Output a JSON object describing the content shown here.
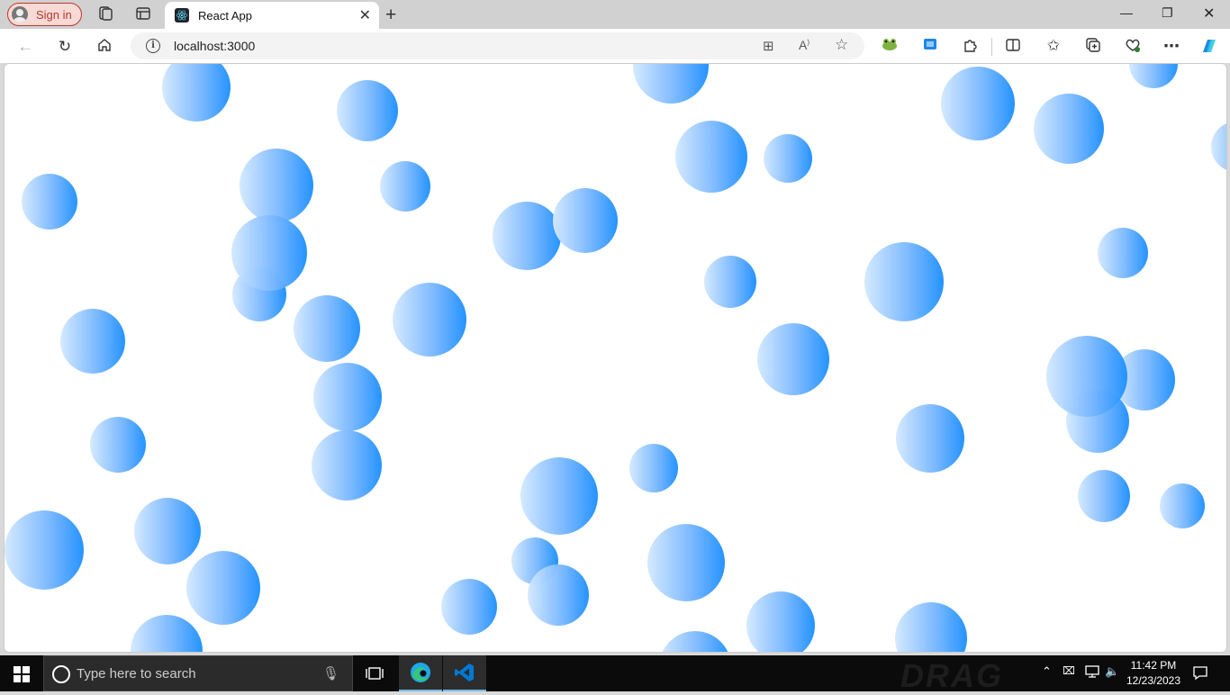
{
  "browser": {
    "sign_in_label": "Sign in",
    "tab_title": "React App",
    "url": "localhost:3000"
  },
  "page": {
    "bubble_color_start": "#d4e9ff",
    "bubble_color_end": "#1e90ff"
  },
  "taskbar": {
    "search_placeholder": "Type here to search",
    "time": "11:42 PM",
    "date": "12/23/2023",
    "watermark": "DRAG"
  },
  "colors": {
    "signin_border": "#c0392b",
    "vscode": "#0078d4",
    "edge": "#1fa9e4"
  }
}
